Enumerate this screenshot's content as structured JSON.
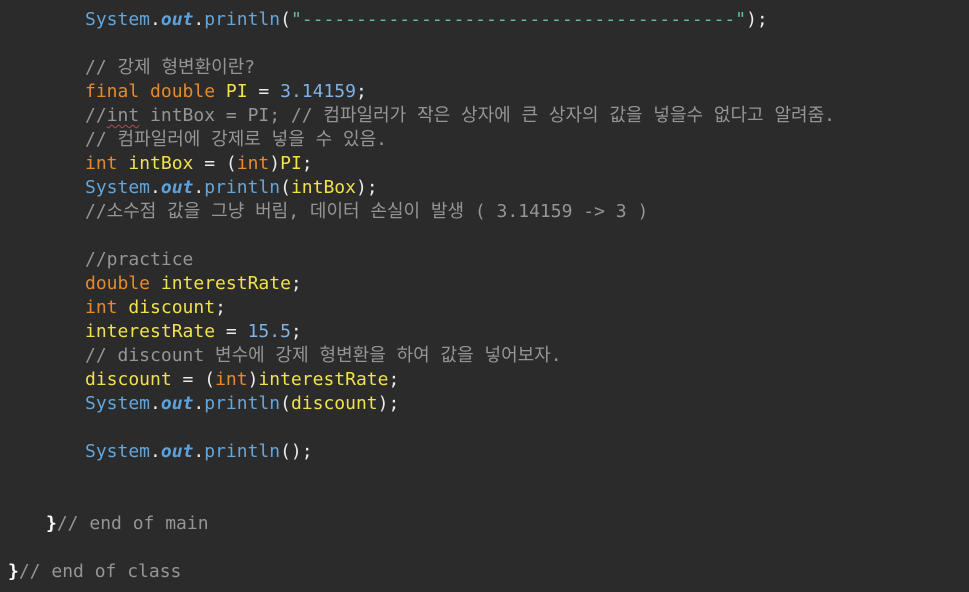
{
  "lines": [
    {
      "tokens": [
        {
          "t": "System",
          "c": "t-sys"
        },
        {
          "t": ".",
          "c": "t-def"
        },
        {
          "t": "out",
          "c": "t-out"
        },
        {
          "t": ".",
          "c": "t-def"
        },
        {
          "t": "println",
          "c": "t-method"
        },
        {
          "t": "(",
          "c": "t-def"
        },
        {
          "t": "\"----------------------------------------\"",
          "c": "t-str"
        },
        {
          "t": ");",
          "c": "t-def"
        }
      ],
      "indent": 2,
      "row": 0
    },
    {
      "tokens": [
        {
          "t": "// 강제 형변환이란?",
          "c": "t-com"
        }
      ],
      "indent": 2,
      "row": 2
    },
    {
      "tokens": [
        {
          "t": "final",
          "c": "t-kw"
        },
        {
          "t": " ",
          "c": "t-def"
        },
        {
          "t": "double",
          "c": "t-kw"
        },
        {
          "t": " ",
          "c": "t-def"
        },
        {
          "t": "PI",
          "c": "t-var"
        },
        {
          "t": " = ",
          "c": "t-def"
        },
        {
          "t": "3.14159",
          "c": "t-num"
        },
        {
          "t": ";",
          "c": "t-def"
        }
      ],
      "indent": 2,
      "row": 3
    },
    {
      "tokens": [
        {
          "t": "//",
          "c": "t-com"
        },
        {
          "t": "int",
          "c": "t-com squiggle"
        },
        {
          "t": " intBox = PI; // 컴파일러가 작은 상자에 큰 상자의 값을 넣을수 없다고 알려줌.",
          "c": "t-com"
        }
      ],
      "indent": 2,
      "row": 4
    },
    {
      "tokens": [
        {
          "t": "// 컴파일러에 강제로 넣을 수 있음.",
          "c": "t-com"
        }
      ],
      "indent": 2,
      "row": 5
    },
    {
      "tokens": [
        {
          "t": "int",
          "c": "t-kw"
        },
        {
          "t": " ",
          "c": "t-def"
        },
        {
          "t": "intBox",
          "c": "t-var"
        },
        {
          "t": " = (",
          "c": "t-def"
        },
        {
          "t": "int",
          "c": "t-kw"
        },
        {
          "t": ")",
          "c": "t-def"
        },
        {
          "t": "PI",
          "c": "t-var"
        },
        {
          "t": ";",
          "c": "t-def"
        }
      ],
      "indent": 2,
      "row": 6
    },
    {
      "tokens": [
        {
          "t": "System",
          "c": "t-sys"
        },
        {
          "t": ".",
          "c": "t-def"
        },
        {
          "t": "out",
          "c": "t-out"
        },
        {
          "t": ".",
          "c": "t-def"
        },
        {
          "t": "println",
          "c": "t-method"
        },
        {
          "t": "(",
          "c": "t-def"
        },
        {
          "t": "intBox",
          "c": "t-var"
        },
        {
          "t": ");",
          "c": "t-def"
        }
      ],
      "indent": 2,
      "row": 7
    },
    {
      "tokens": [
        {
          "t": "//소수점 값을 그냥 버림, 데이터 손실이 발생 ( 3.14159 -> 3 )",
          "c": "t-com"
        }
      ],
      "indent": 2,
      "row": 8
    },
    {
      "tokens": [
        {
          "t": "//practice",
          "c": "t-com"
        }
      ],
      "indent": 2,
      "row": 10
    },
    {
      "tokens": [
        {
          "t": "double",
          "c": "t-kw"
        },
        {
          "t": " ",
          "c": "t-def"
        },
        {
          "t": "interestRate",
          "c": "t-var"
        },
        {
          "t": ";",
          "c": "t-def"
        }
      ],
      "indent": 2,
      "row": 11
    },
    {
      "tokens": [
        {
          "t": "int",
          "c": "t-kw"
        },
        {
          "t": " ",
          "c": "t-def"
        },
        {
          "t": "discount",
          "c": "t-var"
        },
        {
          "t": ";",
          "c": "t-def"
        }
      ],
      "indent": 2,
      "row": 12
    },
    {
      "tokens": [
        {
          "t": "interestRate",
          "c": "t-var"
        },
        {
          "t": " = ",
          "c": "t-def"
        },
        {
          "t": "15.5",
          "c": "t-num"
        },
        {
          "t": ";",
          "c": "t-def"
        }
      ],
      "indent": 2,
      "row": 13
    },
    {
      "tokens": [
        {
          "t": "// discount 변수에 강제 형변환을 하여 값을 넣어보자.",
          "c": "t-com"
        }
      ],
      "indent": 2,
      "row": 14
    },
    {
      "tokens": [
        {
          "t": "discount",
          "c": "t-var"
        },
        {
          "t": " = (",
          "c": "t-def"
        },
        {
          "t": "int",
          "c": "t-kw"
        },
        {
          "t": ")",
          "c": "t-def"
        },
        {
          "t": "interestRate",
          "c": "t-var"
        },
        {
          "t": ";",
          "c": "t-def"
        }
      ],
      "indent": 2,
      "row": 15
    },
    {
      "tokens": [
        {
          "t": "System",
          "c": "t-sys"
        },
        {
          "t": ".",
          "c": "t-def"
        },
        {
          "t": "out",
          "c": "t-out"
        },
        {
          "t": ".",
          "c": "t-def"
        },
        {
          "t": "println",
          "c": "t-method"
        },
        {
          "t": "(",
          "c": "t-def"
        },
        {
          "t": "discount",
          "c": "t-var"
        },
        {
          "t": ");",
          "c": "t-def"
        }
      ],
      "indent": 2,
      "row": 16
    },
    {
      "tokens": [
        {
          "t": "System",
          "c": "t-sys"
        },
        {
          "t": ".",
          "c": "t-def"
        },
        {
          "t": "out",
          "c": "t-out"
        },
        {
          "t": ".",
          "c": "t-def"
        },
        {
          "t": "println",
          "c": "t-method"
        },
        {
          "t": "();",
          "c": "t-def"
        }
      ],
      "indent": 2,
      "row": 18
    },
    {
      "tokens": [
        {
          "t": "}",
          "c": "t-brace"
        },
        {
          "t": "// end of main",
          "c": "t-com"
        }
      ],
      "indent": 1,
      "row": 21
    },
    {
      "tokens": [
        {
          "t": "}",
          "c": "t-brace"
        },
        {
          "t": "// end of class",
          "c": "t-com"
        }
      ],
      "indent": 0,
      "row": 23
    }
  ],
  "colors": {
    "background": "#2b2b2b",
    "keyword": "#e78a2d",
    "variable": "#f0e24c",
    "comment": "#959595",
    "class": "#62a6dc",
    "string": "#5fc39c",
    "number": "#7fb2e6"
  }
}
